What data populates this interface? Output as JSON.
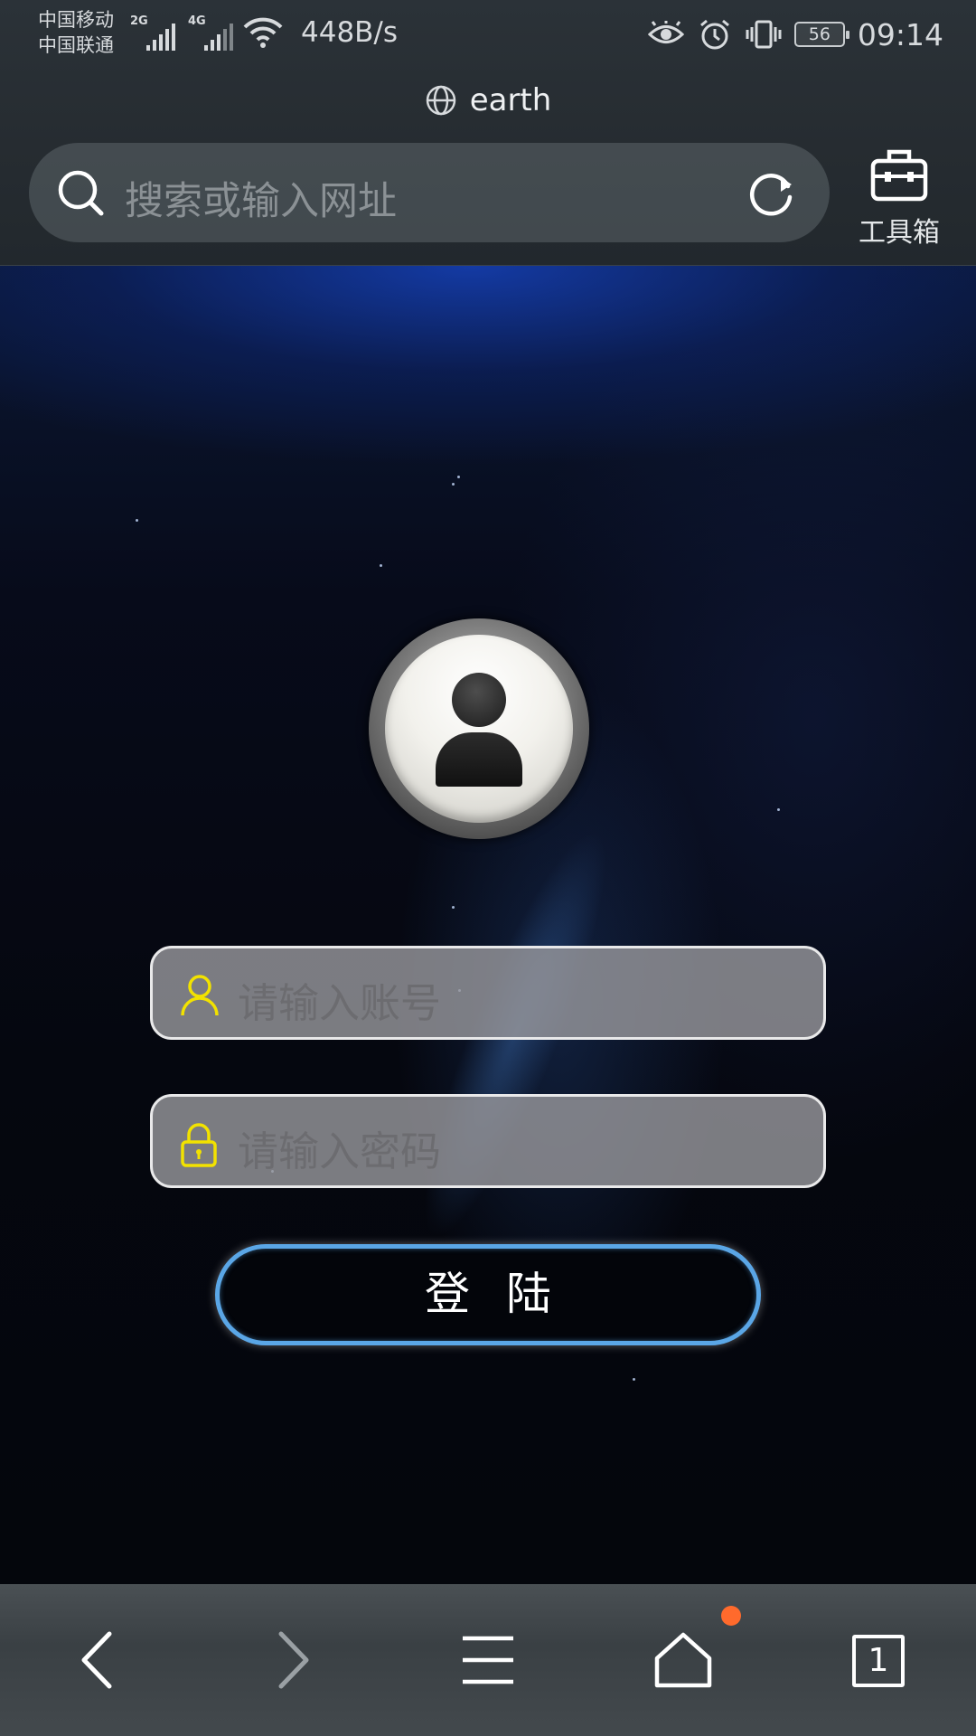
{
  "status_bar": {
    "carrier_1": "中国移动",
    "carrier_2": "中国联通",
    "net_1": "2G",
    "net_2": "4G",
    "speed": "448B/s",
    "battery": "56",
    "time": "09:14",
    "icons": [
      "signal-icon",
      "wifi-icon",
      "eye-icon",
      "alarm-icon",
      "vibrate-icon",
      "battery-icon"
    ]
  },
  "browser": {
    "page_host": "earth",
    "search_placeholder": "搜索或输入网址",
    "toolbox_label": "工具箱"
  },
  "login": {
    "account_placeholder": "请输入账号",
    "password_placeholder": "请输入密码",
    "login_label": "登陆",
    "colors": {
      "input_icon": "#f2e200",
      "button_border": "#5aa6e6"
    }
  },
  "bottom_nav": {
    "tab_count": "1",
    "badge_color": "#ff6a2c"
  }
}
